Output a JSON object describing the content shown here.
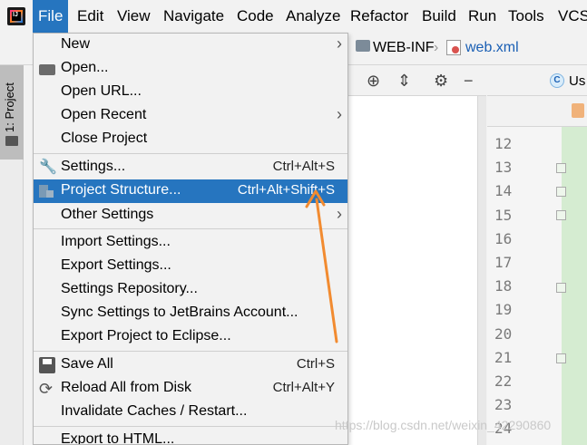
{
  "menubar": {
    "items": [
      "File",
      "Edit",
      "View",
      "Navigate",
      "Code",
      "Analyze",
      "Refactor",
      "Build",
      "Run",
      "Tools",
      "VCS"
    ],
    "active": "File"
  },
  "breadcrumb": {
    "folder": "WEB-INF",
    "file": "web.xml"
  },
  "sidebar": {
    "project_tab": "1: Project"
  },
  "editor": {
    "tab_label": "Us",
    "tab_icon_letter": "C",
    "line_numbers": [
      "12",
      "13",
      "14",
      "15",
      "16",
      "17",
      "18",
      "19",
      "20",
      "21",
      "22",
      "23",
      "24"
    ]
  },
  "file_menu": {
    "items": [
      {
        "label": "New",
        "submenu": true
      },
      {
        "label": "Open...",
        "icon": "folder-open-icon"
      },
      {
        "label": "Open URL..."
      },
      {
        "label": "Open Recent",
        "submenu": true
      },
      {
        "label": "Close Project"
      },
      {
        "label": "Settings...",
        "shortcut": "Ctrl+Alt+S",
        "icon": "wrench-icon"
      },
      {
        "label": "Project Structure...",
        "shortcut": "Ctrl+Alt+Shift+S",
        "icon": "project-structure-icon",
        "selected": true
      },
      {
        "label": "Other Settings",
        "submenu": true
      },
      {
        "label": "Import Settings..."
      },
      {
        "label": "Export Settings..."
      },
      {
        "label": "Settings Repository..."
      },
      {
        "label": "Sync Settings to JetBrains Account..."
      },
      {
        "label": "Export Project to Eclipse..."
      },
      {
        "label": "Save All",
        "shortcut": "Ctrl+S",
        "icon": "save-icon"
      },
      {
        "label": "Reload All from Disk",
        "shortcut": "Ctrl+Alt+Y",
        "icon": "reload-icon"
      },
      {
        "label": "Invalidate Caches / Restart..."
      },
      {
        "label": "Export to HTML..."
      }
    ]
  },
  "watermark": "https://blog.csdn.net/weixin_42290860",
  "colors": {
    "selection": "#2675bf",
    "annotation_arrow": "#f28b30"
  }
}
